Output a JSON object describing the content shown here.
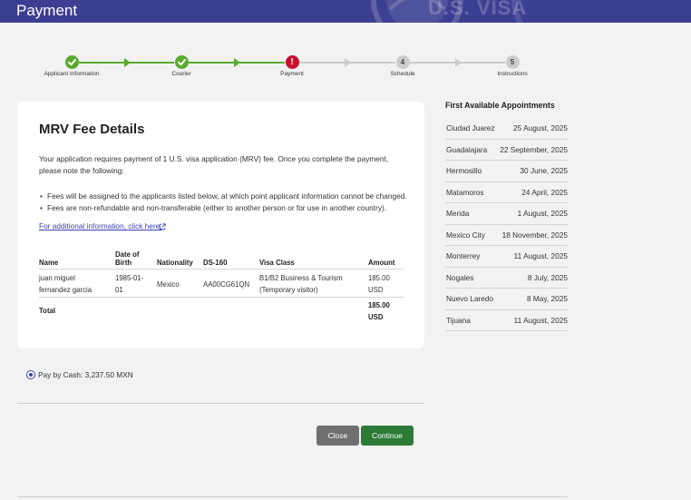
{
  "header": {
    "title": "Payment",
    "seal_text": "U.S. VISA"
  },
  "stepper": {
    "steps": [
      {
        "label": "Applicant Information",
        "status": "complete",
        "icon": "check-icon",
        "number": ""
      },
      {
        "label": "Courier",
        "status": "complete",
        "icon": "check-icon",
        "number": ""
      },
      {
        "label": "Payment",
        "status": "current",
        "icon": "exclamation-icon",
        "number": "!"
      },
      {
        "label": "Schedule",
        "status": "pending",
        "icon": "",
        "number": "4"
      },
      {
        "label": "Instructions",
        "status": "pending",
        "icon": "",
        "number": "5"
      }
    ],
    "colors": {
      "complete": "#5aaa2e",
      "current": "#c8102e",
      "pending": "#cccccc"
    }
  },
  "fee_card": {
    "title": "MRV Fee Details",
    "intro": "Your application requires payment of 1 U.S. visa application (MRV) fee. Once you complete the payment, please note the following:",
    "bullets": [
      "Fees will be assigned to the applicants listed below, at which point applicant information cannot be changed.",
      "Fees are non-refundable and non-transferable (either to another person or for use in another country)."
    ],
    "link_text": "For additional information, click here.",
    "table": {
      "headers": {
        "name": "Name",
        "dob_line1": "Date of",
        "dob_line2": "Birth",
        "nationality": "Nationality",
        "ds160": "DS-160",
        "visa_class": "Visa Class",
        "amount": "Amount"
      },
      "rows": [
        {
          "name_line1": "juan miguel",
          "name_line2": "fernandez garcia",
          "dob_line1": "1985-01-",
          "dob_line2": "01",
          "nationality": "Mexico",
          "ds160": "AA00CG61QN",
          "visa_class_line1": "B1/B2 Business & Tourism",
          "visa_class_line2": "(Temporary visitor)",
          "amount_line1": "185.00",
          "amount_line2": "USD"
        }
      ],
      "total_label": "Total",
      "total_line1": "185.00",
      "total_line2": "USD"
    }
  },
  "payment_option": {
    "label": "Pay by Cash: 3,237.50 MXN",
    "selected": true
  },
  "buttons": {
    "close": "Close",
    "continue": "Continue"
  },
  "appointments": {
    "title": "First Available Appointments",
    "items": [
      {
        "city": "Ciudad Juarez",
        "date": "25 August, 2025"
      },
      {
        "city": "Guadalajara",
        "date": "22 September, 2025"
      },
      {
        "city": "Hermosillo",
        "date": "30 June, 2025"
      },
      {
        "city": "Matamoros",
        "date": "24 April, 2025"
      },
      {
        "city": "Merida",
        "date": "1 August, 2025"
      },
      {
        "city": "Mexico City",
        "date": "18 November, 2025"
      },
      {
        "city": "Monterrey",
        "date": "11 August, 2025"
      },
      {
        "city": "Nogales",
        "date": "8 July, 2025"
      },
      {
        "city": "Nuevo Laredo",
        "date": "8 May, 2025"
      },
      {
        "city": "Tijuana",
        "date": "11 August, 2025"
      }
    ]
  }
}
